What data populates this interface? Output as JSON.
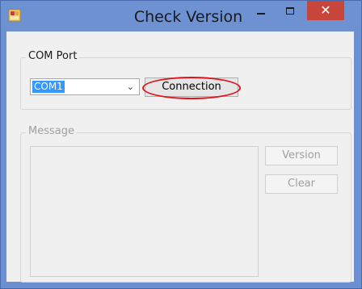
{
  "window": {
    "title": "Check Version",
    "close_glyph": "✕"
  },
  "com_port": {
    "legend": "COM Port",
    "selected": "COM1",
    "connect_label": "Connection"
  },
  "message": {
    "legend": "Message",
    "version_label": "Version",
    "clear_label": "Clear"
  },
  "icons": [
    "app-icon",
    "minimize-icon",
    "maximize-icon",
    "close-icon",
    "dropdown-arrow-icon"
  ],
  "colors": {
    "titlebar": "#6d91d1",
    "close_button": "#c7453a",
    "highlight_ring": "#e1131b",
    "selection": "#3399ff"
  }
}
